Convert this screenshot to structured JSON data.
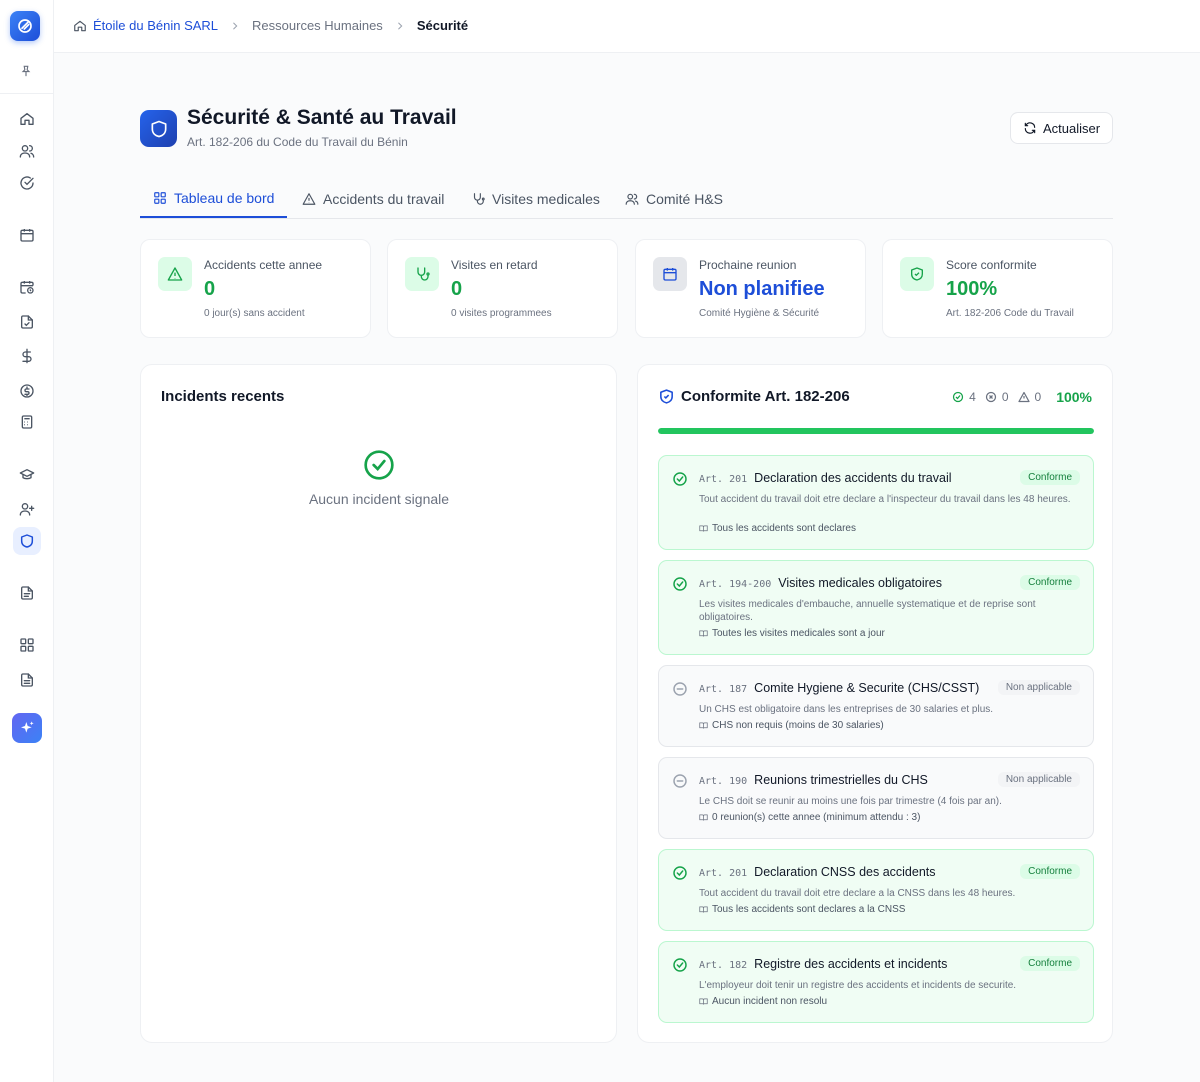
{
  "breadcrumb": {
    "company": "Étoile du Bénin SARL",
    "section": "Ressources Humaines",
    "current": "Sécurité"
  },
  "header": {
    "title": "Sécurité & Santé au Travail",
    "subtitle": "Art. 182-206 du Code du Travail du Bénin",
    "refresh_label": "Actualiser"
  },
  "tabs": [
    "Tableau de bord",
    "Accidents du travail",
    "Visites medicales",
    "Comité H&S"
  ],
  "stats": [
    {
      "label": "Accidents cette annee",
      "value": "0",
      "foot": "0 jour(s) sans accident",
      "color": "#16a34a"
    },
    {
      "label": "Visites en retard",
      "value": "0",
      "foot": "0 visites programmees",
      "color": "#16a34a"
    },
    {
      "label": "Prochaine reunion",
      "value": "Non planifiee",
      "foot": "Comité Hygiène & Sécurité",
      "color": "#1d4ed8"
    },
    {
      "label": "Score conformite",
      "value": "100%",
      "foot": "Art. 182-206 Code du Travail",
      "color": "#16a34a"
    }
  ],
  "incidents": {
    "title": "Incidents recents",
    "empty_text": "Aucun incident signale"
  },
  "compliance": {
    "title": "Conformite Art. 182-206",
    "ok_count": "4",
    "fail_count": "0",
    "warn_count": "0",
    "percent": "100%",
    "progress": 1.0,
    "rules": [
      {
        "article": "Art. 201",
        "name": "Declaration des accidents du travail",
        "status": "Conforme",
        "desc": "Tout accident du travail doit etre declare a l'inspecteur du travail dans les 48 heures.",
        "note": "Tous les accidents sont declares"
      },
      {
        "article": "Art. 194-200",
        "name": "Visites medicales obligatoires",
        "status": "Conforme",
        "desc": "Les visites medicales d'embauche, annuelle systematique et de reprise sont obligatoires.",
        "note": "Toutes les visites medicales sont a jour"
      },
      {
        "article": "Art. 187",
        "name": "Comite Hygiene & Securite (CHS/CSST)",
        "status": "Non applicable",
        "desc": "Un CHS est obligatoire dans les entreprises de 30 salaries et plus.",
        "note": "CHS non requis (moins de 30 salaries)"
      },
      {
        "article": "Art. 190",
        "name": "Reunions trimestrielles du CHS",
        "status": "Non applicable",
        "desc": "Le CHS doit se reunir au moins une fois par trimestre (4 fois par an).",
        "note": "0 reunion(s) cette annee (minimum attendu : 3)"
      },
      {
        "article": "Art. 201",
        "name": "Declaration CNSS des accidents",
        "status": "Conforme",
        "desc": "Tout accident du travail doit etre declare a la CNSS dans les 48 heures.",
        "note": "Tous les accidents sont declares a la CNSS"
      },
      {
        "article": "Art. 182",
        "name": "Registre des accidents et incidents",
        "status": "Conforme",
        "desc": "L'employeur doit tenir un registre des accidents et incidents de securite.",
        "note": "Aucun incident non resolu"
      }
    ]
  }
}
